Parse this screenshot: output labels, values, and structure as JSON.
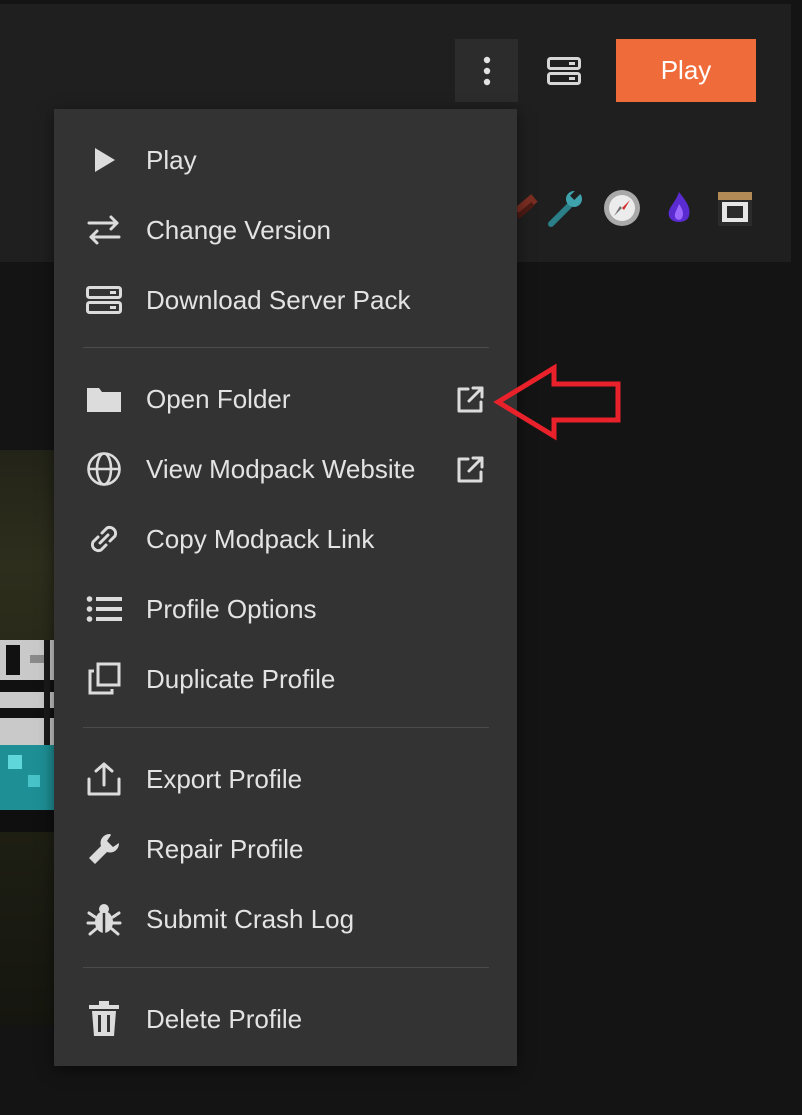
{
  "header": {
    "more_icon": "more-vertical-icon",
    "server_icon": "server-icon",
    "play_label": "Play",
    "play_color": "#f06b3a",
    "mod_icons": [
      "book-icon",
      "wrench-icon",
      "compass-icon",
      "purple-flame-icon",
      "crafting-block-icon"
    ]
  },
  "menu": {
    "groups": [
      [
        {
          "label": "Play",
          "icon": "play-icon"
        },
        {
          "label": "Change Version",
          "icon": "swap-arrows-icon"
        },
        {
          "label": "Download Server Pack",
          "icon": "server-icon"
        }
      ],
      [
        {
          "label": "Open Folder",
          "icon": "folder-icon",
          "external": "external-link-icon"
        },
        {
          "label": "View Modpack Website",
          "icon": "globe-icon",
          "external": "external-link-icon"
        },
        {
          "label": "Copy Modpack Link",
          "icon": "link-icon"
        },
        {
          "label": "Profile Options",
          "icon": "list-icon"
        },
        {
          "label": "Duplicate Profile",
          "icon": "duplicate-icon"
        }
      ],
      [
        {
          "label": "Export Profile",
          "icon": "export-icon"
        },
        {
          "label": "Repair Profile",
          "icon": "wrench-icon"
        },
        {
          "label": "Submit Crash Log",
          "icon": "bug-icon"
        }
      ],
      [
        {
          "label": "Delete Profile",
          "icon": "trash-icon"
        }
      ]
    ]
  },
  "annotation": {
    "arrow_icon": "red-arrow-icon",
    "color": "#e8212b"
  }
}
